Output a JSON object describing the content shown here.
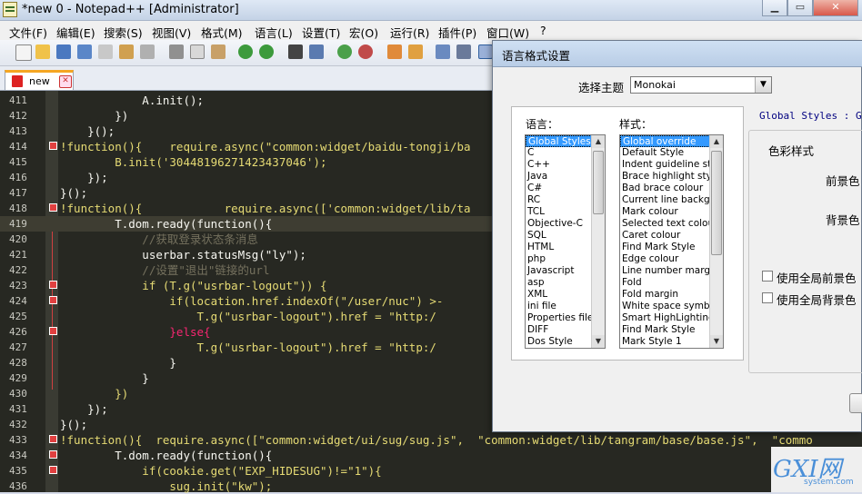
{
  "window": {
    "title": "*new  0 - Notepad++ [Administrator]"
  },
  "menu": [
    "文件(F)",
    "编辑(E)",
    "搜索(S)",
    "视图(V)",
    "格式(M)",
    "语言(L)",
    "设置(T)",
    "宏(O)",
    "运行(R)",
    "插件(P)",
    "窗口(W)",
    "?"
  ],
  "tab": {
    "label": "new"
  },
  "code": [
    {
      "n": "411",
      "t": "            A.init();"
    },
    {
      "n": "412",
      "t": "        })"
    },
    {
      "n": "413",
      "t": "    }();"
    },
    {
      "n": "414",
      "t": "!function(){    require.async(\"common:widget/baidu-tongji/ba"
    },
    {
      "n": "415",
      "t": "        B.init('30448196271423437046');"
    },
    {
      "n": "416",
      "t": "    });"
    },
    {
      "n": "417",
      "t": "}();"
    },
    {
      "n": "418",
      "t": "!function(){            require.async(['common:widget/lib/ta"
    },
    {
      "n": "419",
      "t": "        T.dom.ready(function(){"
    },
    {
      "n": "420",
      "t": "            //获取登录状态条消息"
    },
    {
      "n": "421",
      "t": "            userbar.statusMsg(\"ly\");"
    },
    {
      "n": "422",
      "t": "            //设置\"退出\"链接的url"
    },
    {
      "n": "423",
      "t": "            if (T.g(\"usrbar-logout\")) {"
    },
    {
      "n": "424",
      "t": "                if(location.href.indexOf(\"/user/nuc\") >-"
    },
    {
      "n": "425",
      "t": "                    T.g(\"usrbar-logout\").href = \"http:/"
    },
    {
      "n": "426",
      "t": "                }else{"
    },
    {
      "n": "427",
      "t": "                    T.g(\"usrbar-logout\").href = \"http:/"
    },
    {
      "n": "428",
      "t": "                }"
    },
    {
      "n": "429",
      "t": "            }"
    },
    {
      "n": "430",
      "t": "        })"
    },
    {
      "n": "431",
      "t": "    });"
    },
    {
      "n": "432",
      "t": "}();"
    },
    {
      "n": "433",
      "t": "!function(){  require.async([\"common:widget/ui/sug/sug.js\",  \"common:widget/lib/tangram/base/base.js\",  \"commo"
    },
    {
      "n": "434",
      "t": "        T.dom.ready(function(){"
    },
    {
      "n": "435",
      "t": "            if(cookie.get(\"EXP_HIDESUG\")!=\"1\"){"
    },
    {
      "n": "436",
      "t": "                sug.init(\"kw\");"
    }
  ],
  "dialog": {
    "title": "语言格式设置",
    "theme_label": "选择主题",
    "theme_value": "Monokai",
    "lang_label": "语言：",
    "style_label": "样式：",
    "languages": [
      "Global Styles",
      "C",
      "C++",
      "Java",
      "C#",
      "RC",
      "TCL",
      "Objective-C",
      "SQL",
      "HTML",
      "php",
      "Javascript",
      "asp",
      "XML",
      "ini file",
      "Properties file",
      "DIFF",
      "Dos Style"
    ],
    "styles": [
      "Global override",
      "Default Style",
      "Indent guideline sty",
      "Brace highlight style",
      "Bad brace colour",
      "Current line backgr",
      "Mark colour",
      "Selected text colour",
      "Caret colour",
      "Find Mark Style",
      "Edge colour",
      "Line number margin",
      "Fold",
      "Fold margin",
      "White space symbo",
      "Smart HighLighting",
      "Find Mark Style",
      "Mark Style 1"
    ],
    "header_text": "Global Styles : Glo",
    "color_group": "色彩样式",
    "fg_label": "前景色",
    "bg_label": "背景色",
    "global_fg": "使用全局前景色",
    "global_bg": "使用全局背景色"
  },
  "watermark": {
    "brand": "GXI网",
    "site": "system.com"
  }
}
